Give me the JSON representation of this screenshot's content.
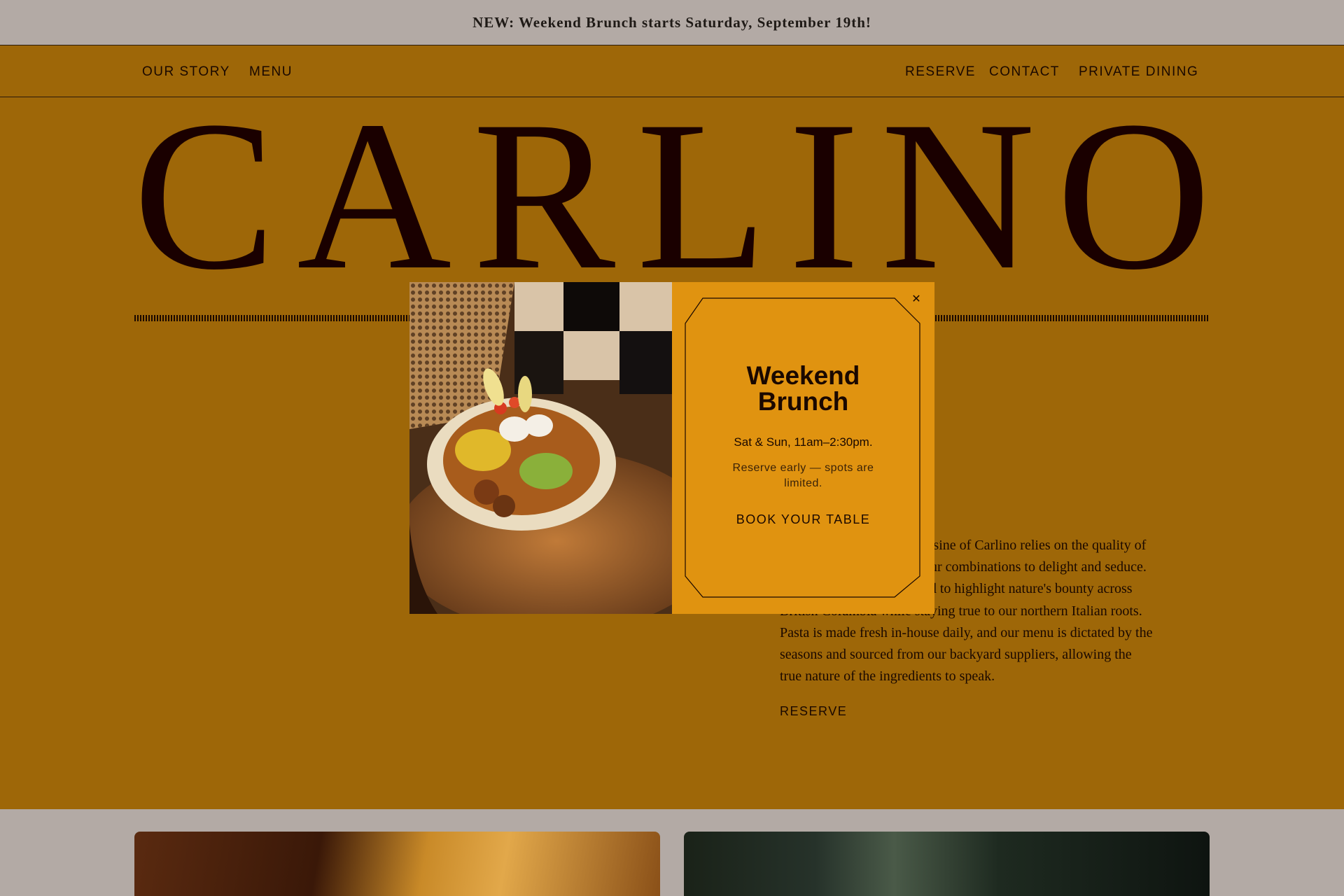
{
  "announcement": {
    "text": "NEW: Weekend Brunch starts Saturday, September 19th!"
  },
  "nav": {
    "left": [
      "OUR STORY",
      "MENU"
    ],
    "right": [
      "RESERVE",
      "CONTACT",
      "PRIVATE DINING"
    ]
  },
  "logo": {
    "letters": [
      "C",
      "A",
      "R",
      "L",
      "I",
      "N",
      "O"
    ]
  },
  "intro": {
    "lines": [
      "cuisine of Carlino relies on the quality of",
      "our combinations to delight and seduce.",
      "ed to highlight nature's bounty across",
      "British Columbia while staying true to our northern Italian roots.",
      "Pasta is made fresh in-house daily, and our menu is dictated by the",
      "seasons and sourced from our backyard suppliers, allowing the",
      "true nature of the ingredients to speak."
    ],
    "reserve_label": "RESERVE"
  },
  "modal": {
    "close_icon": "close-icon",
    "title_line1": "Weekend",
    "title_line2": "Brunch",
    "hours": "Sat & Sun, 11am–2:30pm.",
    "note": "Reserve early — spots are limited.",
    "button_label": "BOOK YOUR TABLE"
  },
  "colors": {
    "page_bg": "#9e6708",
    "announce_bg": "#b3aaa5",
    "modal_panel": "#e09310",
    "ink": "#1a0800"
  }
}
